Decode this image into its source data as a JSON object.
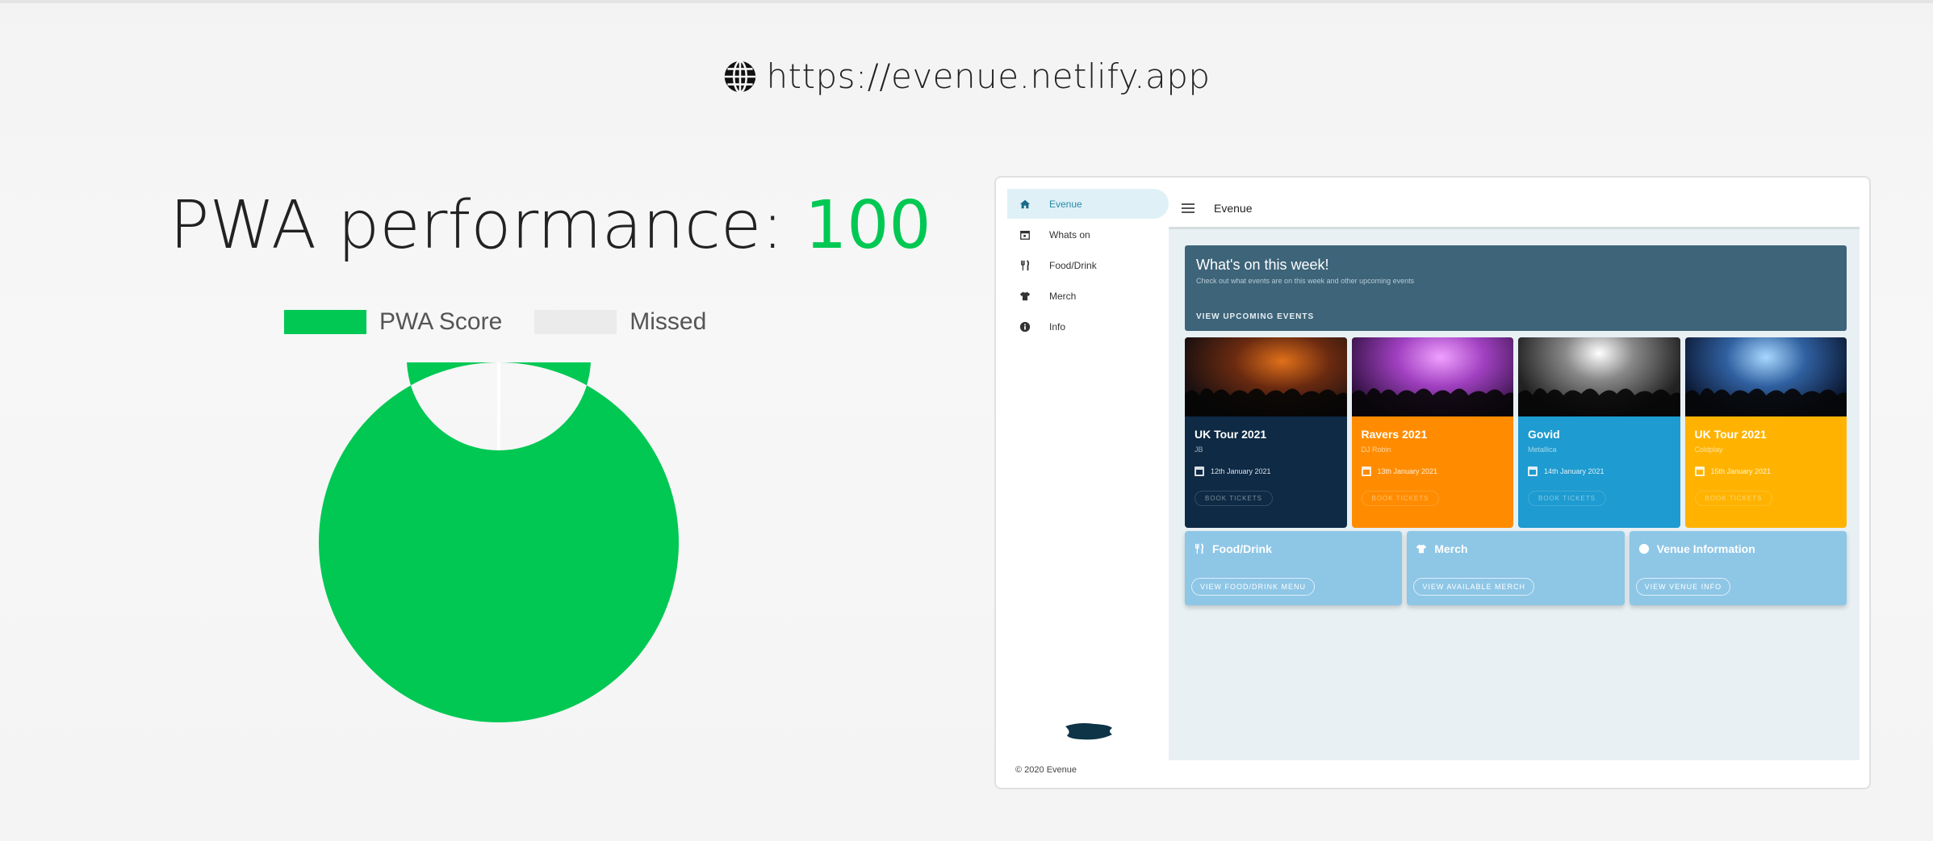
{
  "header": {
    "url": "https://evenue.netlify.app",
    "icon": "globe-icon"
  },
  "score": {
    "label": "PWA performance: ",
    "value": "100",
    "value_color": "#00c853",
    "legend": [
      {
        "label": "PWA Score",
        "color": "#00c853"
      },
      {
        "label": "Missed",
        "color": "#ebebeb"
      }
    ]
  },
  "chart_data": {
    "type": "pie",
    "categories": [
      "PWA Score",
      "Missed"
    ],
    "values": [
      100,
      0
    ],
    "colors": [
      "#00c853",
      "#ebebeb"
    ],
    "legend_position": "top"
  },
  "app": {
    "title": "Evenue",
    "nav": [
      {
        "label": "Evenue",
        "icon": "home-icon",
        "active": true
      },
      {
        "label": "Whats on",
        "icon": "calendar-icon",
        "active": false
      },
      {
        "label": "Food/Drink",
        "icon": "utensils-icon",
        "active": false
      },
      {
        "label": "Merch",
        "icon": "shirt-icon",
        "active": false
      },
      {
        "label": "Info",
        "icon": "info-icon",
        "active": false
      }
    ],
    "hero": {
      "title": "What's on this week!",
      "subtitle": "Check out what events are on this week and other upcoming events",
      "button": "VIEW UPCOMING EVENTS"
    },
    "events": [
      {
        "name": "UK Tour 2021",
        "artist": "JB",
        "date": "12th January 2021",
        "button": "BOOK TICKETS",
        "color": "#0e2a45"
      },
      {
        "name": "Ravers 2021",
        "artist": "DJ Robin",
        "date": "13th January 2021",
        "button": "BOOK TICKETS",
        "color": "#ff8c00"
      },
      {
        "name": "Govid",
        "artist": "Metallica",
        "date": "14th January 2021",
        "button": "BOOK TICKETS",
        "color": "#1e9bd0"
      },
      {
        "name": "UK Tour 2021",
        "artist": "Coldplay",
        "date": "15th January 2021",
        "button": "BOOK TICKETS",
        "color": "#ffb300"
      }
    ],
    "info_cards": [
      {
        "title": "Food/Drink",
        "icon": "utensils-icon",
        "button": "VIEW FOOD/DRINK MENU"
      },
      {
        "title": "Merch",
        "icon": "shirt-icon",
        "button": "VIEW AVAILABLE MERCH"
      },
      {
        "title": "Venue Information",
        "icon": "info-icon",
        "button": "VIEW VENUE INFO"
      }
    ],
    "footer": "© 2020 Evenue",
    "logo_text": "Evenue"
  }
}
